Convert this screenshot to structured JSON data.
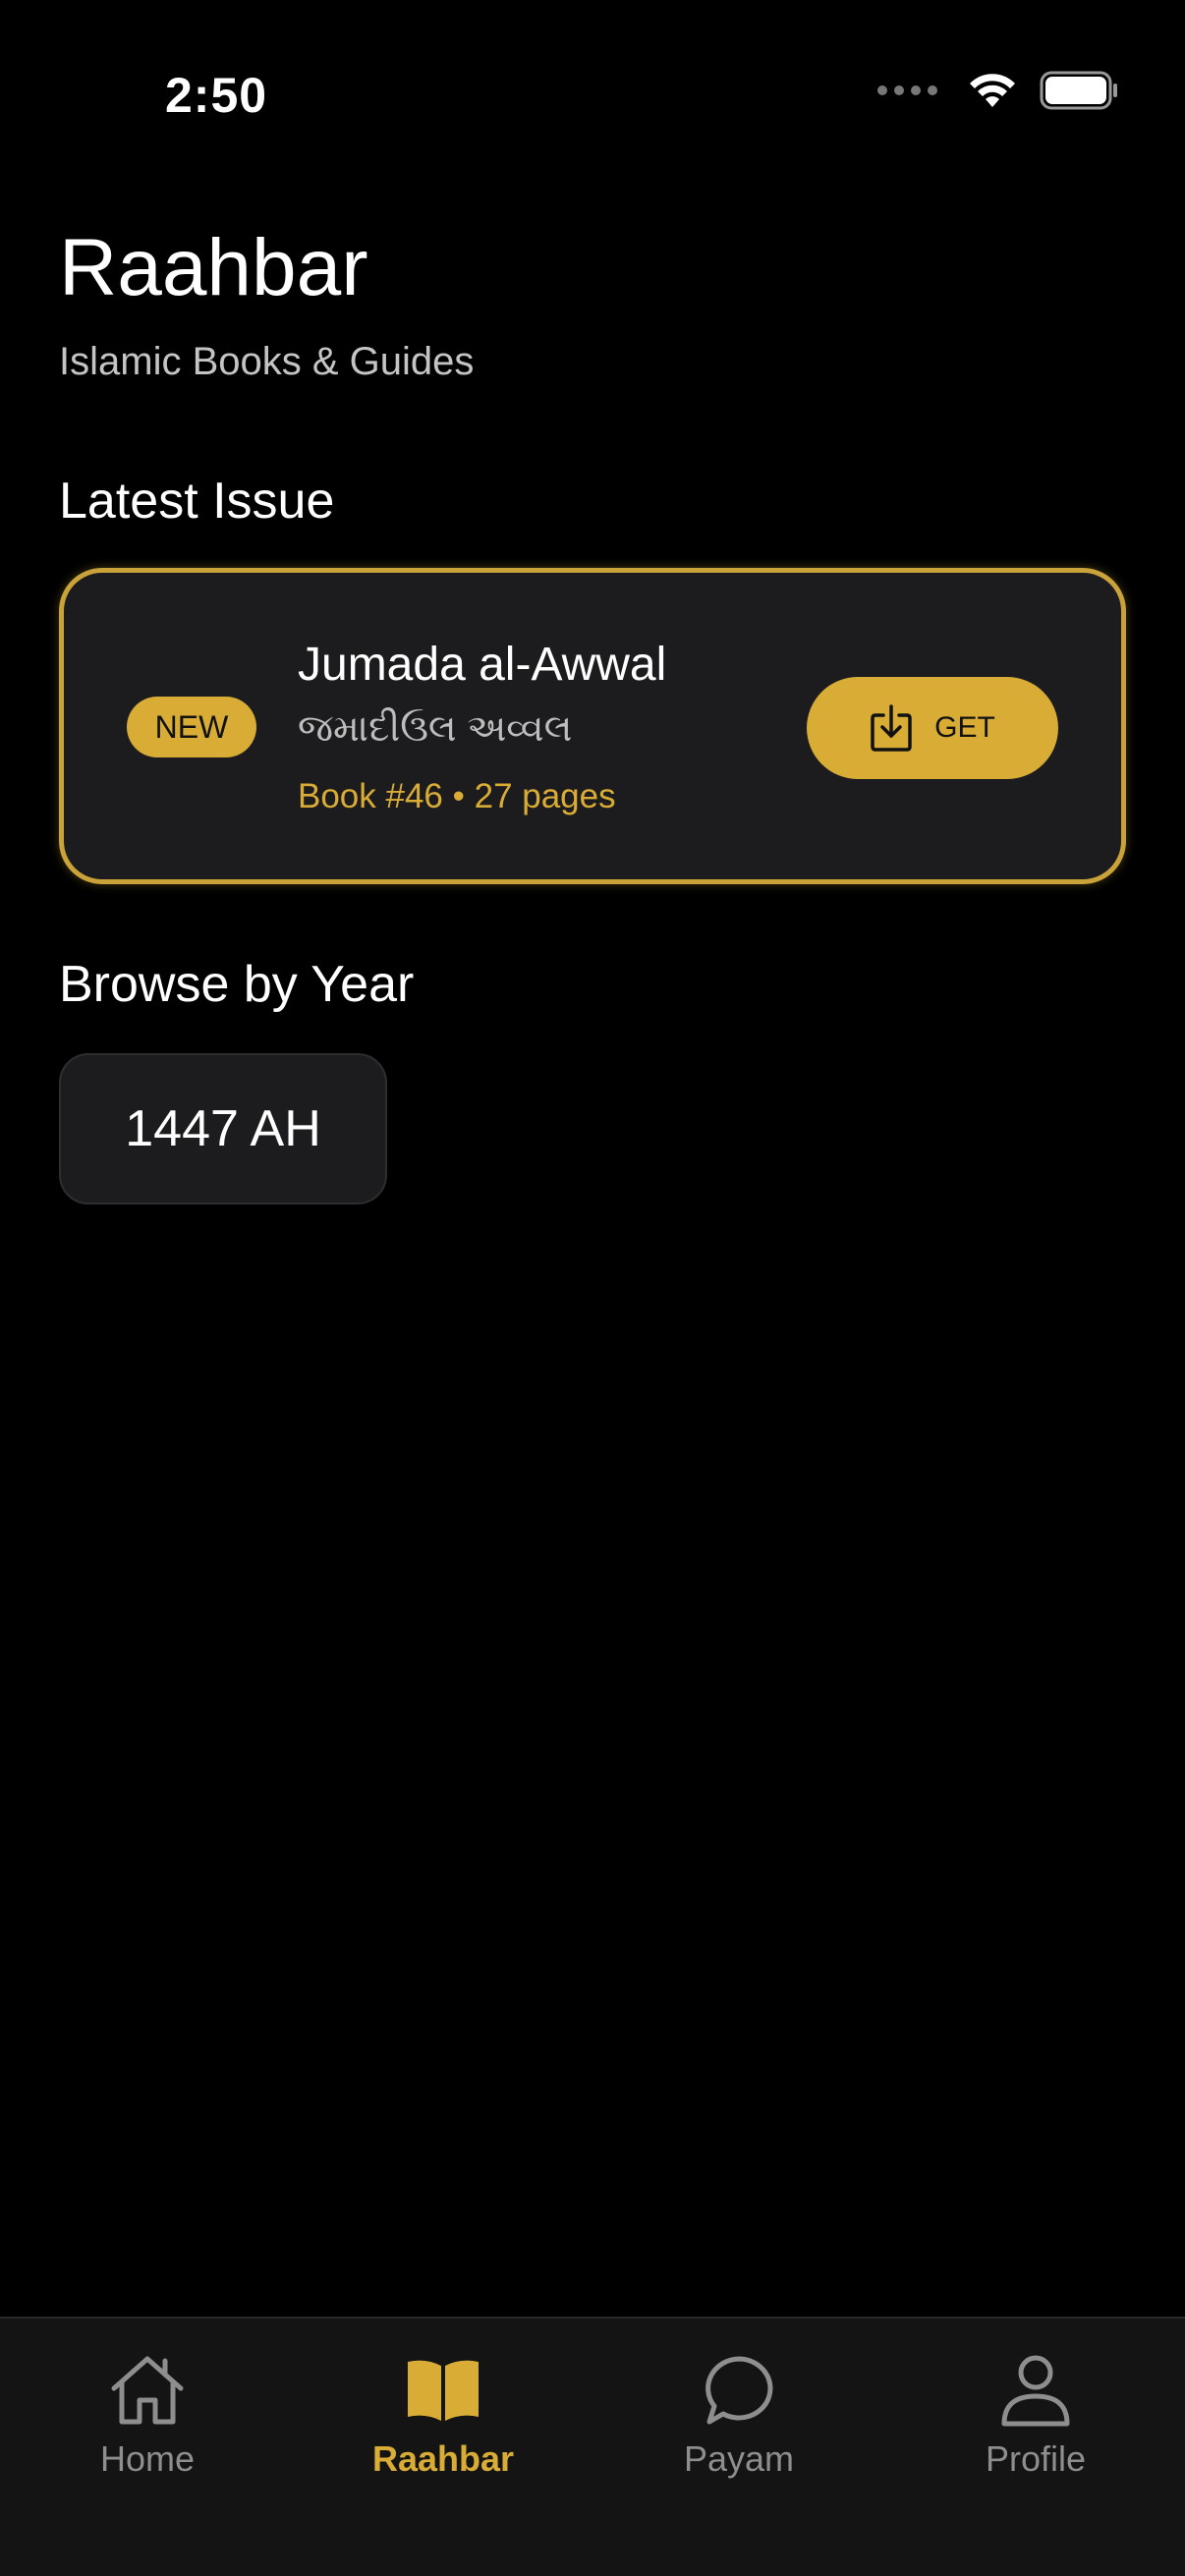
{
  "status_bar": {
    "time": "2:50"
  },
  "header": {
    "title": "Raahbar",
    "subtitle": "Islamic Books & Guides"
  },
  "latest_issue": {
    "section_title": "Latest Issue",
    "badge": "NEW",
    "title": "Jumada al-Awwal",
    "subtitle": "જમાદીઉલ અવ્વલ",
    "meta": "Book #46 • 27 pages",
    "button_label": "GET"
  },
  "browse": {
    "section_title": "Browse by Year",
    "years": [
      "1447 AH"
    ]
  },
  "tab_bar": {
    "items": [
      {
        "label": "Home",
        "icon": "home-icon",
        "active": false
      },
      {
        "label": "Raahbar",
        "icon": "book-icon",
        "active": true
      },
      {
        "label": "Payam",
        "icon": "chat-bubble-icon",
        "active": false
      },
      {
        "label": "Profile",
        "icon": "person-icon",
        "active": false
      }
    ]
  },
  "colors": {
    "accent": "#d9ad35",
    "background": "#000000",
    "card": "#1c1c1e",
    "inactive_tab": "#8e8e8e"
  }
}
